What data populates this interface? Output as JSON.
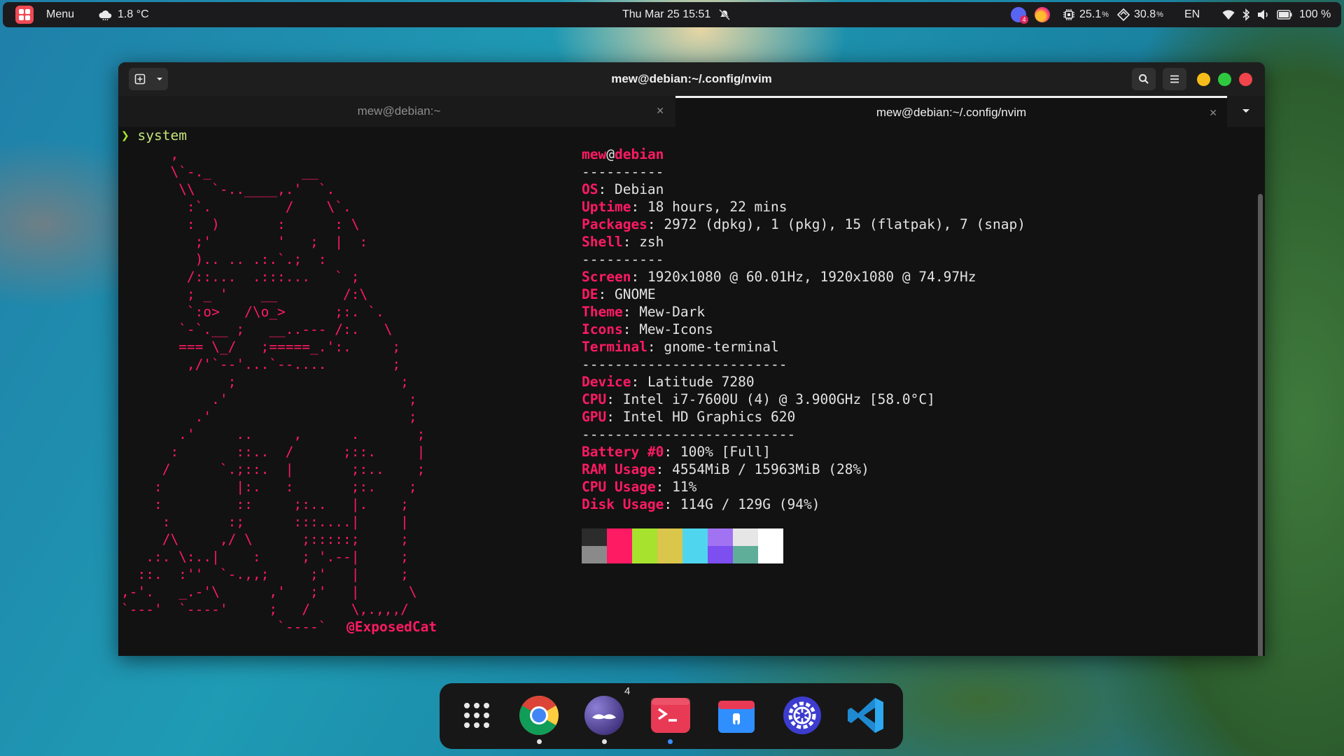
{
  "topbar": {
    "menu_label": "Menu",
    "weather": "1.8 °C",
    "datetime": "Thu Mar 25  15:51",
    "notification_badge": "4",
    "cpu": "25.1",
    "ram": "30.8",
    "percent_unit": "%",
    "lang": "EN",
    "battery": "100 %"
  },
  "window": {
    "title": "mew@debian:~/.config/nvim",
    "tabs": [
      {
        "label": "mew@debian:~",
        "active": false
      },
      {
        "label": "mew@debian:~/.config/nvim",
        "active": true
      }
    ]
  },
  "terminal": {
    "prompt_symbol": "❯",
    "command": "system",
    "ascii_art": "      ,\n      \\`-._           __\n       \\\\  `-..____,.'  `.\n        :`.         /    \\`.\n        :  )       :      : \\\n         ;'        '   ;  |  :\n         ).. .. .:.`.;  :\n        /::...  .:::...   ` ;\n        ; _ '    __        /:\\\n        `:o>   /\\o_>      ;:. `.\n       `-`.__ ;   __..--- /:.   \\\n       === \\_/   ;=====_.':.     ;\n        ,/'`--'...`--....        ;\n             ;                    ;\n           .'                      ;\n         .'                        ;\n       .'     ..     ,      .       ;\n      :       ::..  /      ;::.     |\n     /      `.;::.  |       ;:..    ;\n    :         |:.   :       ;:.    ;\n    :         ::     ;:..   |.    ;\n     :       :;      :::....|     |\n     /\\     ,/ \\      ;:::::;     ;\n   .:. \\:..|    :     ; '.--|     ;\n  ::.  :''  `-.,,;     ;'   |     ;\n,-'.   _.-'\\      ,'   ;'   |      \\\n`---'  `----'     ;   /     \\,.,,,/\n                   `----`",
    "ascii_credit": "@ExposedCat",
    "user": "mew",
    "at": "@",
    "host": "debian",
    "sep1": "----------",
    "sep2": "----------",
    "sep3": "-------------------------",
    "sep4": "--------------------------",
    "fields": {
      "os": {
        "key": "OS",
        "value": "Debian"
      },
      "uptime": {
        "key": "Uptime",
        "value": "18 hours, 22 mins"
      },
      "packages": {
        "key": "Packages",
        "value": "2972 (dpkg), 1 (pkg), 15 (flatpak), 7 (snap)"
      },
      "shell": {
        "key": "Shell",
        "value": "zsh"
      },
      "screen": {
        "key": "Screen",
        "value": "1920x1080 @ 60.01Hz, 1920x1080 @ 74.97Hz"
      },
      "de": {
        "key": "DE",
        "value": "GNOME"
      },
      "theme": {
        "key": "Theme",
        "value": "Mew-Dark"
      },
      "icons": {
        "key": "Icons",
        "value": "Mew-Icons"
      },
      "terminal": {
        "key": "Terminal",
        "value": "gnome-terminal"
      },
      "device": {
        "key": "Device",
        "value": "Latitude 7280"
      },
      "cpu": {
        "key": "CPU",
        "value": "Intel i7-7600U (4) @ 3.900GHz [58.0°C]"
      },
      "gpu": {
        "key": "GPU",
        "value": "Intel HD Graphics 620"
      },
      "battery": {
        "key": "Battery #0",
        "value": "100% [Full]"
      },
      "ram": {
        "key": "RAM Usage",
        "value": "4554MiB / 15963MiB (28%)"
      },
      "cpu_usage": {
        "key": "CPU Usage",
        "value": "11%"
      },
      "disk": {
        "key": "Disk Usage",
        "value": "114G / 129G (94%)"
      }
    },
    "palette_top": [
      "#2c2c2c",
      "#ff1a64",
      "#a6e22e",
      "#d9c64a",
      "#4fd6ee",
      "#a173f2",
      "#e6e6e6",
      "#ffffff"
    ],
    "palette_bottom": [
      "#8a8a8a",
      "#ff1a64",
      "#a6e22e",
      "#d9c64a",
      "#4fd6ee",
      "#7d4ef0",
      "#5fae9a",
      "#ffffff"
    ]
  },
  "dock": {
    "items": [
      {
        "name": "app-grid",
        "icon": "grid-icon"
      },
      {
        "name": "chrome",
        "icon": "chrome-icon",
        "running": true
      },
      {
        "name": "discord",
        "icon": "discord-icon",
        "running": true,
        "badge": "4"
      },
      {
        "name": "terminal",
        "icon": "terminal-icon",
        "running": true
      },
      {
        "name": "files",
        "icon": "folder-icon"
      },
      {
        "name": "settings",
        "icon": "settings-icon"
      },
      {
        "name": "vscode",
        "icon": "vscode-icon"
      }
    ]
  }
}
